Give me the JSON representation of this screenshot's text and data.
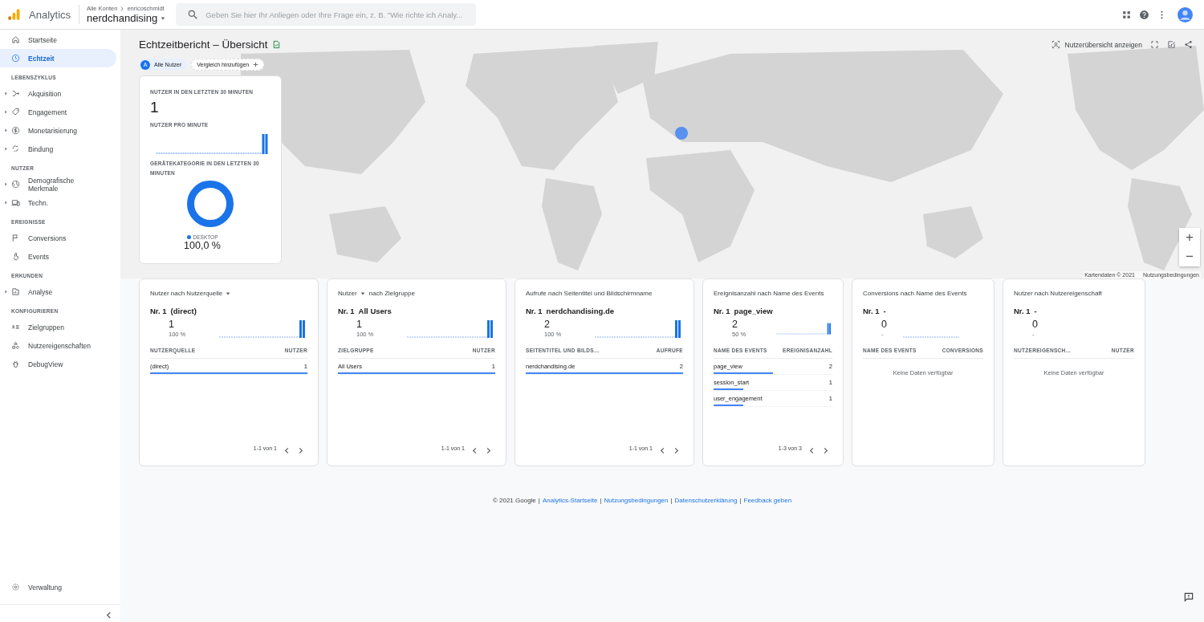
{
  "header": {
    "app_name": "Analytics",
    "breadcrumb": [
      "Alle Konten",
      "enricoschmidt"
    ],
    "property": "nerdchandising",
    "search": {
      "placeholder": "Geben Sie hier Ihr Anliegen oder Ihre Frage ein, z. B. \"Wie richte ich Analy..."
    }
  },
  "sidebar": {
    "sections": [
      {
        "items": [
          {
            "label": "Startseite",
            "selected": false,
            "expandable": false
          },
          {
            "label": "Echtzeit",
            "selected": true,
            "expandable": false
          }
        ]
      },
      {
        "heading": "LEBENSZYKLUS",
        "items": [
          {
            "label": "Akquisition",
            "selected": false,
            "expandable": true
          },
          {
            "label": "Engagement",
            "selected": false,
            "expandable": true
          },
          {
            "label": "Monetarisierung",
            "selected": false,
            "expandable": true
          },
          {
            "label": "Bindung",
            "selected": false,
            "expandable": true
          }
        ]
      },
      {
        "heading": "NUTZER",
        "items": [
          {
            "label": "Demografische Merkmale",
            "selected": false,
            "expandable": true
          },
          {
            "label": "Techn.",
            "selected": false,
            "expandable": true
          }
        ]
      },
      {
        "heading": "EREIGNISSE",
        "items": [
          {
            "label": "Conversions",
            "selected": false,
            "expandable": false
          },
          {
            "label": "Events",
            "selected": false,
            "expandable": false
          }
        ]
      },
      {
        "heading": "ERKUNDEN",
        "items": [
          {
            "label": "Analyse",
            "selected": false,
            "expandable": true
          }
        ]
      },
      {
        "heading": "KONFIGURIEREN",
        "items": [
          {
            "label": "Zielgruppen",
            "selected": false,
            "expandable": false
          },
          {
            "label": "Nutzereigenschaften",
            "selected": false,
            "expandable": false
          },
          {
            "label": "DebugView",
            "selected": false,
            "expandable": false
          }
        ]
      }
    ],
    "footer_item": {
      "label": "Verwaltung",
      "selected": false
    }
  },
  "report": {
    "title": "Echtzeitbericht – Übersicht",
    "chips": [
      {
        "badge": "A",
        "label": "Alle Nutzer"
      },
      {
        "label": "Vergleich hinzufügen"
      }
    ],
    "user_snapshot_button": "Nutzerübersicht anzeigen"
  },
  "map": {
    "kind": "picture",
    "attribution": "Kartendaten © 2021",
    "terms": "Nutzungsbedingungen",
    "zoom_in": "+",
    "zoom_out": "−"
  },
  "overview_card": {
    "users_label": "NUTZER IN DEN LETZTEN 30 MINUTEN",
    "users_value": "1",
    "per_minute_label": "NUTZER PRO MINUTE",
    "device_label": "GERÄTEKATEGORIE IN DEN LETZTEN 30 MINUTEN",
    "legend": [
      {
        "label": "DESKTOP",
        "value": "100,0 %",
        "color": "#1a73e8"
      }
    ]
  },
  "cards": [
    {
      "title": [
        {
          "text": "Nutzer nach Nutzerquelle",
          "dropdown": true
        }
      ],
      "rank": "Nr. 1",
      "top": "(direct)",
      "value": "1",
      "share": "100 %",
      "trend_line": true,
      "trend_spike": true,
      "columns": [
        "NUTZERQUELLE",
        "NUTZER"
      ],
      "rows": [
        {
          "label": "(direct)",
          "value": "1",
          "level": 1
        }
      ],
      "pagination": "1-1 von 1"
    },
    {
      "title": [
        {
          "text": "Nutzer",
          "dropdown": true
        },
        {
          "text": "nach Zielgruppe",
          "dropdown": false
        }
      ],
      "rank": "Nr. 1",
      "top": "All Users",
      "value": "1",
      "share": "100 %",
      "trend_line": true,
      "trend_spike": true,
      "columns": [
        "ZIELGRUPPE",
        "NUTZER"
      ],
      "rows": [
        {
          "label": "All Users",
          "value": "1",
          "level": 1
        }
      ],
      "pagination": "1-1 von 1"
    },
    {
      "title": [
        {
          "text": "Aufrufe nach Seitentitel und Bildschirmname",
          "dropdown": false
        }
      ],
      "rank": "Nr. 1",
      "top": "nerdchandising.de",
      "value": "2",
      "share": "100 %",
      "trend_line": true,
      "trend_spike": true,
      "columns": [
        "SEITENTITEL UND BILDS…",
        "AUFRUFE"
      ],
      "rows": [
        {
          "label": "nerdchandising.de",
          "value": "2",
          "level": 1
        }
      ],
      "pagination": "1-1 von 1"
    },
    {
      "title": [
        {
          "text": "Ereignisanzahl nach Name des Events",
          "dropdown": false
        }
      ],
      "rank": "Nr. 1",
      "top": "page_view",
      "value": "2",
      "share": "50 %",
      "trend_line": true,
      "trend_spike": true,
      "columns": [
        "NAME DES EVENTS",
        "EREIGNISANZAHL"
      ],
      "rows": [
        {
          "label": "page_view",
          "value": "2",
          "level": 0.5
        },
        {
          "label": "session_start",
          "value": "1",
          "level": 0.25
        },
        {
          "label": "user_engagement",
          "value": "1",
          "level": 0.25
        }
      ],
      "pagination": "1-3 von 3"
    },
    {
      "title": [
        {
          "text": "Conversions nach Name des Events",
          "dropdown": false
        }
      ],
      "rank": "Nr. 1",
      "top": "-",
      "value": "0",
      "share": "-",
      "trend_line": true,
      "trend_spike": false,
      "columns": [
        "NAME DES EVENTS",
        "CONVERSIONS"
      ],
      "empty_text": "Keine Daten verfügbar"
    },
    {
      "title": [
        {
          "text": "Nutzer nach Nutzereigenschaft",
          "dropdown": false
        }
      ],
      "rank": "Nr. 1",
      "top": "-",
      "value": "0",
      "share": "-",
      "trend_line": false,
      "trend_spike": false,
      "columns": [
        "NUTZEREIGENSCH…",
        "NUTZER"
      ],
      "empty_text": "Keine Daten verfügbar"
    }
  ],
  "footer": {
    "copyright": "© 2021 Google",
    "links": [
      {
        "separator": "|",
        "label": "Analytics-Startseite"
      },
      {
        "separator": "|",
        "label": "Nutzungsbedingungen"
      },
      {
        "separator": "|",
        "label": "Datenschutzerklärung"
      },
      {
        "separator": "|",
        "label": "Feedback geben"
      }
    ]
  }
}
